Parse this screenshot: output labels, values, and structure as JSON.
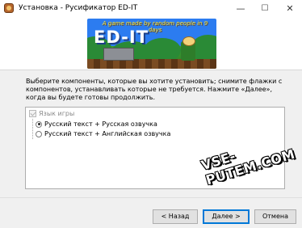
{
  "window": {
    "title": "Установка - Русификатор ED-IT",
    "controls": {
      "minimize": "—",
      "maximize": "☐",
      "close": "✕"
    }
  },
  "banner": {
    "logo_text": "ED-IT",
    "tagline": "A game made by random people in 9 days"
  },
  "instructions": "Выберите компоненты, которые вы хотите установить; снимите флажки с компонентов, устанавливать которые не требуется. Нажмите «Далее», когда вы будете готовы продолжить.",
  "components": {
    "group_label": "Язык игры",
    "group_checked": true,
    "options": [
      {
        "label": "Русский текст + Русская озвучка",
        "selected": true
      },
      {
        "label": "Русский текст + Английская озвучка",
        "selected": false
      }
    ]
  },
  "watermark": "VSE-PUTEM.COM",
  "buttons": {
    "back": "< Назад",
    "next": "Далее >",
    "cancel": "Отмена"
  },
  "icons": [
    "installer-app-icon",
    "minimize-icon",
    "maximize-icon",
    "close-icon"
  ]
}
